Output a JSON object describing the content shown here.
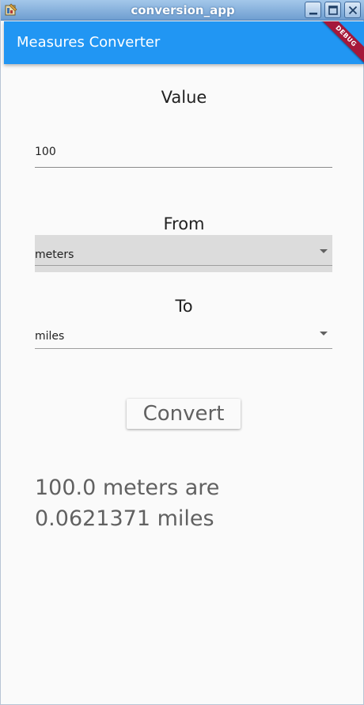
{
  "window": {
    "title": "conversion_app"
  },
  "appbar": {
    "title": "Measures Converter",
    "debug_banner": "DEBUG",
    "color": "#2196f3"
  },
  "form": {
    "value_label": "Value",
    "value_input": "100",
    "from_label": "From",
    "from_selected": "meters",
    "to_label": "To",
    "to_selected": "miles",
    "convert_label": "Convert"
  },
  "result": {
    "line1": "100.0 meters are",
    "line2": "0.0621371 miles"
  },
  "icons": {
    "window_minimize": "minimize-icon",
    "window_maximize": "maximize-icon",
    "window_close": "close-icon",
    "dropdown": "dropdown-arrow-icon"
  }
}
